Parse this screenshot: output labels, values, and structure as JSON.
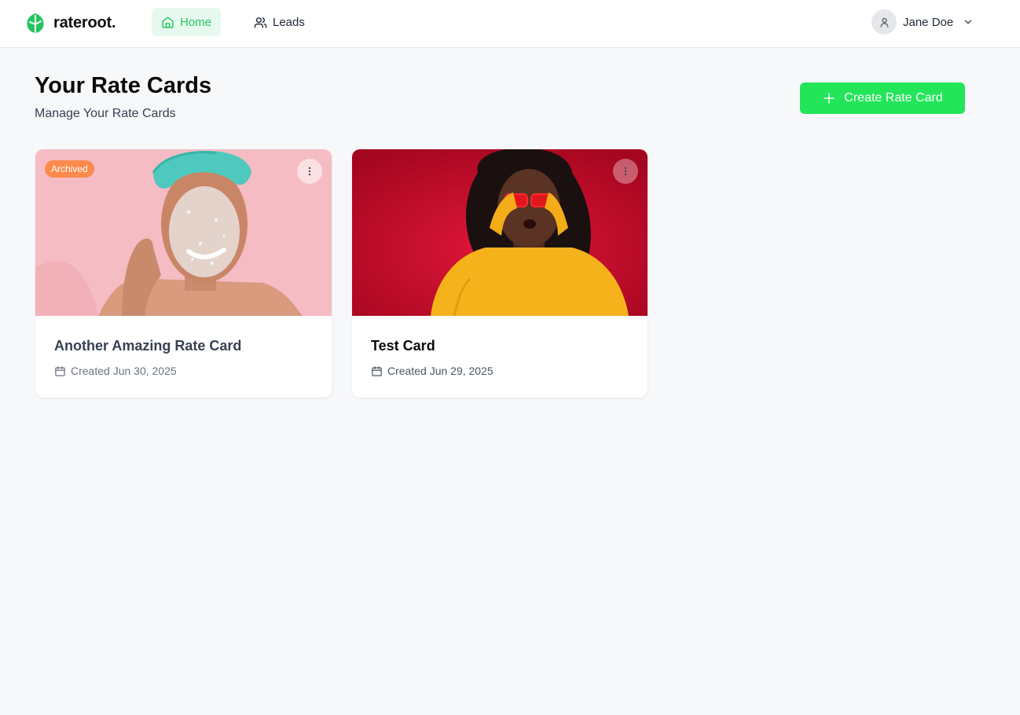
{
  "app": {
    "name": "rateroot."
  },
  "nav": {
    "items": [
      {
        "label": "Home",
        "active": true,
        "icon": "home-icon"
      },
      {
        "label": "Leads",
        "active": false,
        "icon": "users-icon"
      }
    ]
  },
  "user": {
    "name": "Jane Doe",
    "icon": "user-icon"
  },
  "page": {
    "title": "Your Rate Cards",
    "subtitle": "Manage Your Rate Cards",
    "create_button": "Create Rate Card"
  },
  "cards": [
    {
      "title": "Another Amazing Rate Card",
      "created": "Created Jun 30, 2025",
      "badge": "Archived",
      "image": "woman-with-face-scrub-photo"
    },
    {
      "title": "Test Card",
      "created": "Created Jun 29, 2025",
      "image": "woman-in-yellow-sweater-with-red-glasses-photo"
    }
  ],
  "colors": {
    "accent": "#22e55a",
    "nav_active_bg": "#e7f9ee",
    "nav_active_text": "#22c55e",
    "badge_archived": "#fb8a4c",
    "background": "#f7f8fa"
  }
}
